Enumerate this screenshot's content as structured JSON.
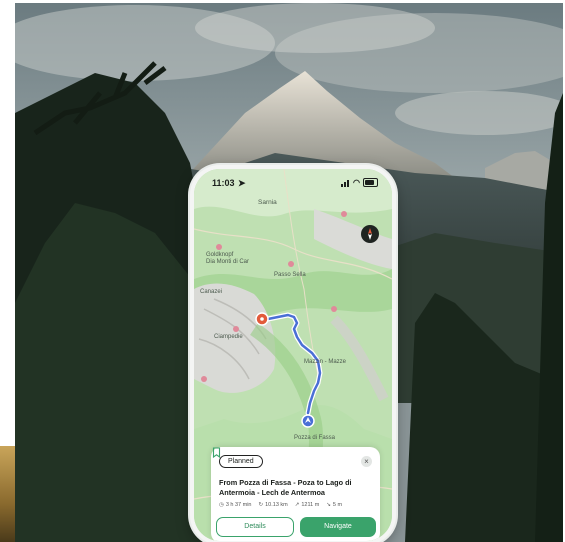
{
  "status_bar": {
    "time": "11:03"
  },
  "map": {
    "labels": {
      "top": "Sarnia",
      "l1": "Goldknopf",
      "l2": "Dia Monti di Car",
      "l3": "Passo Sella",
      "l4": "Canazei",
      "l5": "Mazzin - Mazze",
      "l6": "Ciampedie",
      "l7": "Pozza di Fassa"
    }
  },
  "route_card": {
    "status_label": "Planned",
    "close_label": "×",
    "title": "From Pozza di Fassa - Poza to Lago di Antermoia - Lech de Antermoa",
    "stats": {
      "duration": "3 h 37 min",
      "distance": "10.13 km",
      "elevation": "1211 m",
      "descent": "5 m"
    },
    "details_button": "Details",
    "navigate_button": "Navigate"
  },
  "colors": {
    "accent_green": "#3aa36b",
    "route_blue": "#4a6fd6",
    "start_marker": "#e25a3b"
  },
  "icons": [
    "location-arrow-icon",
    "signal-icon",
    "wifi-icon",
    "battery-icon",
    "compass-icon",
    "bookmark-icon",
    "close-icon",
    "clock-icon",
    "distance-icon",
    "ascent-icon",
    "descent-icon",
    "start-marker-icon",
    "location-dot-icon"
  ]
}
